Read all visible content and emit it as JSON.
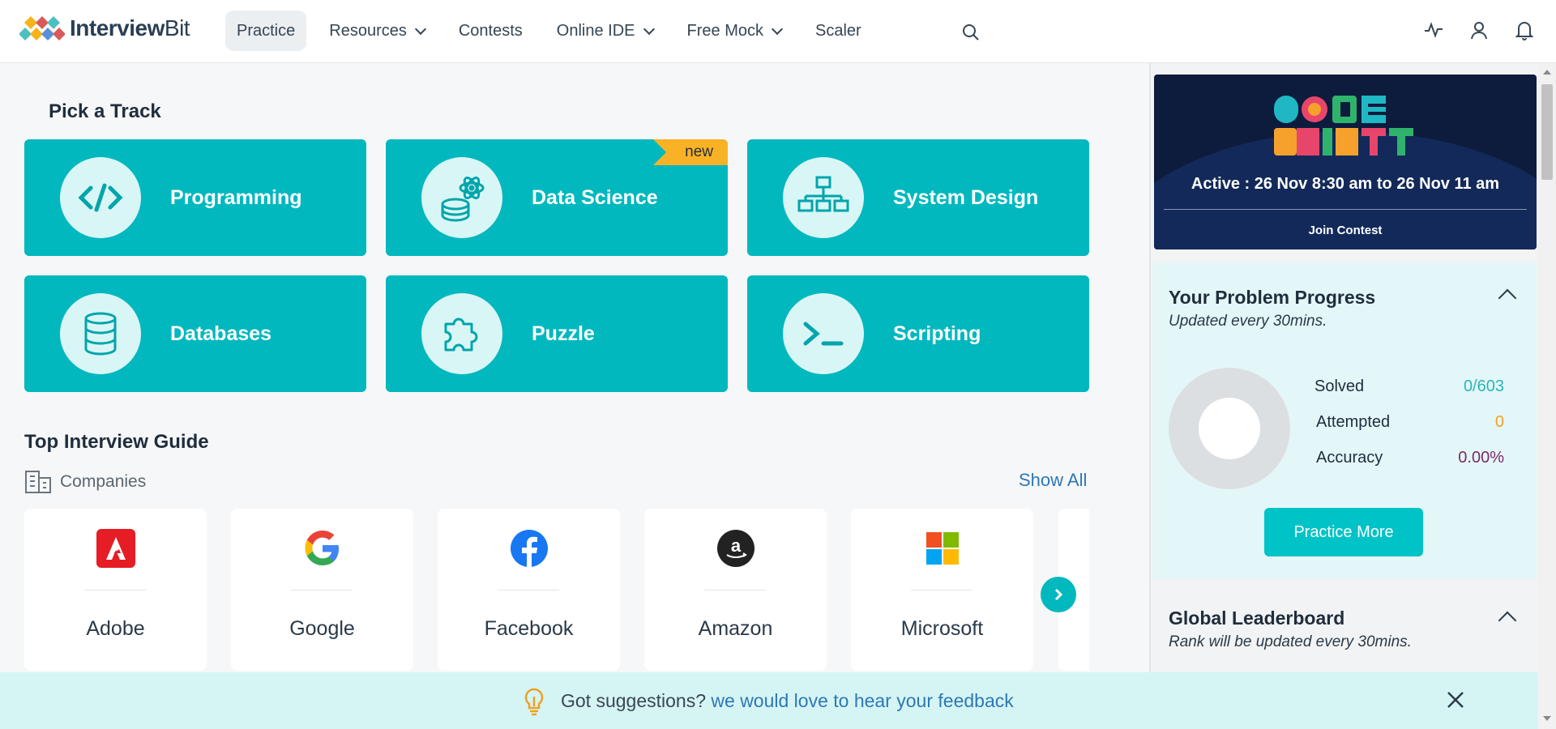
{
  "header": {
    "logo_bold": "Interview",
    "logo_light": "Bit",
    "nav": [
      {
        "label": "Practice",
        "active": true,
        "dropdown": false
      },
      {
        "label": "Resources",
        "active": false,
        "dropdown": true
      },
      {
        "label": "Contests",
        "active": false,
        "dropdown": false
      },
      {
        "label": "Online IDE",
        "active": false,
        "dropdown": true
      },
      {
        "label": "Free Mock",
        "active": false,
        "dropdown": true
      },
      {
        "label": "Scaler",
        "active": false,
        "dropdown": false
      }
    ],
    "icons": [
      "search-icon",
      "activity-icon",
      "user-icon",
      "bell-icon"
    ]
  },
  "tracks": {
    "title": "Pick a Track",
    "items": [
      {
        "label": "Programming",
        "icon": "code-icon"
      },
      {
        "label": "Data Science",
        "icon": "data-science-icon",
        "badge": "new"
      },
      {
        "label": "System Design",
        "icon": "hierarchy-icon"
      },
      {
        "label": "Databases",
        "icon": "database-icon"
      },
      {
        "label": "Puzzle",
        "icon": "puzzle-icon"
      },
      {
        "label": "Scripting",
        "icon": "terminal-icon"
      }
    ]
  },
  "guide": {
    "title": "Top Interview Guide",
    "companies_label": "Companies",
    "show_all": "Show All",
    "companies": [
      {
        "name": "Adobe",
        "icon": "adobe-logo"
      },
      {
        "name": "Google",
        "icon": "google-logo"
      },
      {
        "name": "Facebook",
        "icon": "facebook-logo"
      },
      {
        "name": "Amazon",
        "icon": "amazon-logo"
      },
      {
        "name": "Microsoft",
        "icon": "microsoft-logo"
      }
    ]
  },
  "contest": {
    "name": "CODE DRIFT",
    "active": "Active : 26 Nov 8:30 am to 26 Nov 11 am",
    "join": "Join Contest"
  },
  "progress": {
    "title": "Your Problem Progress",
    "subtitle": "Updated every 30mins.",
    "stats": [
      {
        "label": "Solved",
        "value": "0/603",
        "color": "#2bb5b8"
      },
      {
        "label": "Attempted",
        "value": "0",
        "color": "#f0a020"
      },
      {
        "label": "Accuracy",
        "value": "0.00%",
        "color": "#7a2a6a"
      }
    ],
    "button": "Practice More"
  },
  "leaderboard": {
    "title": "Global Leaderboard",
    "subtitle": "Rank will be updated every 30mins."
  },
  "feedback": {
    "text": "Got suggestions?",
    "link": "we would love to hear your feedback"
  },
  "colors": {
    "teal": "#00b8be",
    "badge": "#f9b226",
    "link": "#2d78b5",
    "banner_bg": "#0d1b3d"
  }
}
